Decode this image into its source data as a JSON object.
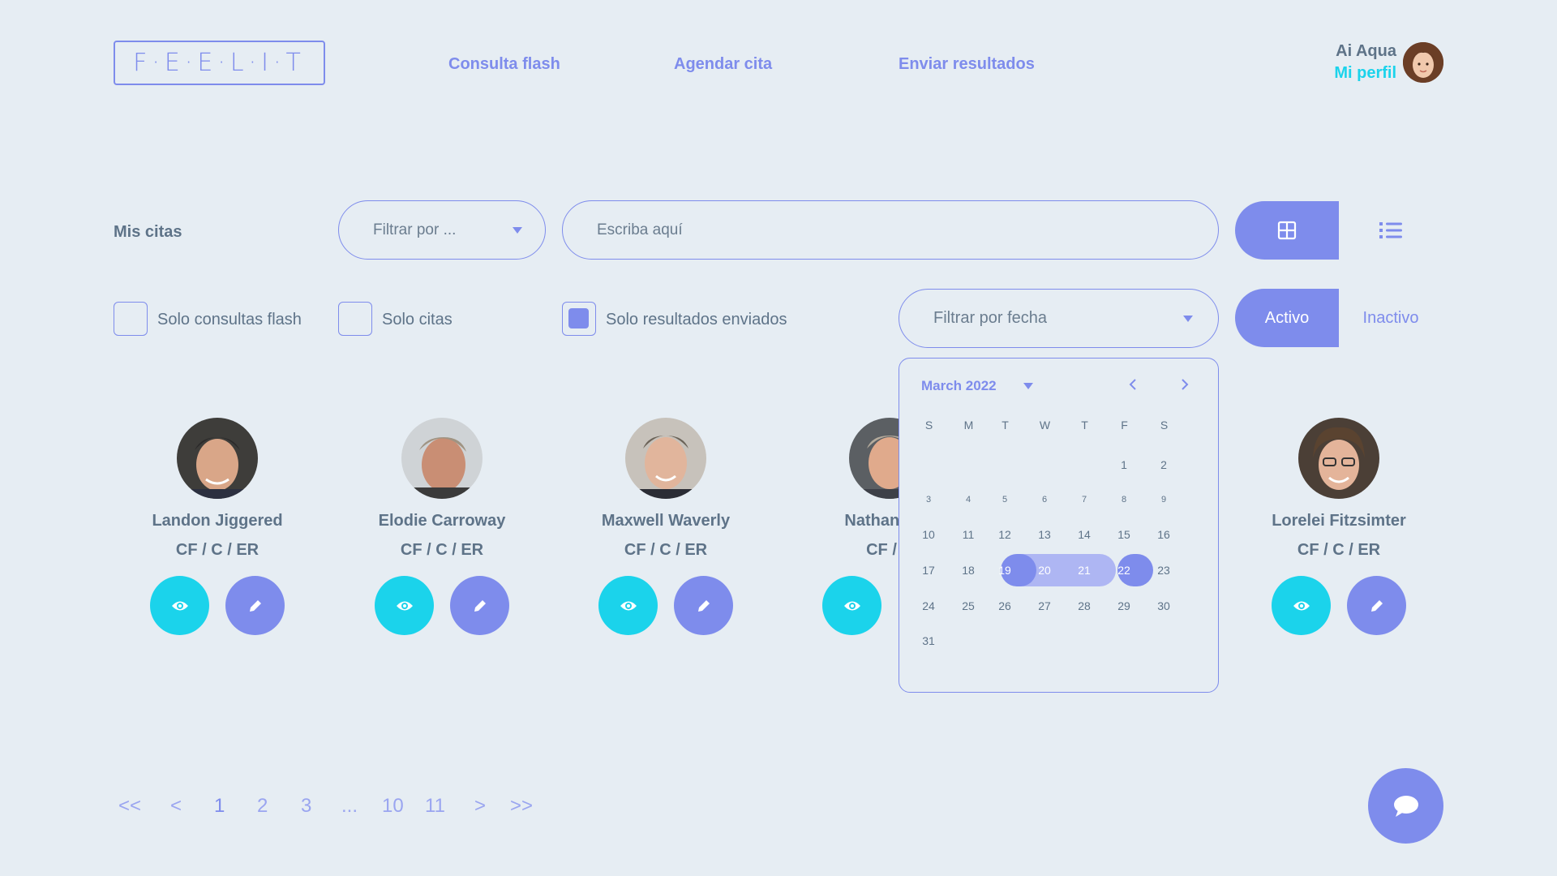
{
  "header": {
    "logo_text": "F·E·E·L·I·T",
    "nav": [
      {
        "label": "Consulta flash"
      },
      {
        "label": "Agendar cita"
      },
      {
        "label": "Enviar resultados"
      }
    ],
    "user": {
      "name": "Ai Aqua",
      "profile_link": "Mi perfil"
    }
  },
  "toolbar": {
    "section_title": "Mis citas",
    "filter_select": {
      "value": "Filtrar por  ..."
    },
    "search": {
      "placeholder": "Escriba aquí"
    },
    "view_grid_icon": "grid-icon",
    "view_list_icon": "list-icon"
  },
  "filters": {
    "checkboxes": [
      {
        "label": "Solo consultas flash",
        "checked": false
      },
      {
        "label": "Solo citas",
        "checked": false
      },
      {
        "label": "Solo resultados enviados",
        "checked": true
      }
    ],
    "date_select": {
      "value": "Filtrar por fecha"
    },
    "status": {
      "active_label": "Activo",
      "inactive_label": "Inactivo",
      "selected": "Activo"
    }
  },
  "calendar": {
    "month_label": "March 2022",
    "weekdays": [
      "S",
      "M",
      "T",
      "W",
      "T",
      "F",
      "S"
    ],
    "weeks": [
      [
        "",
        "",
        "",
        "",
        "",
        "1",
        "2"
      ],
      [
        "3",
        "4",
        "5",
        "6",
        "7",
        "8",
        "9"
      ],
      [
        "10",
        "11",
        "12",
        "13",
        "14",
        "15",
        "16"
      ],
      [
        "17",
        "18",
        "19",
        "20",
        "21",
        "22",
        "23"
      ],
      [
        "24",
        "25",
        "26",
        "27",
        "28",
        "29",
        "30"
      ],
      [
        "31",
        "",
        "",
        "",
        "",
        "",
        ""
      ]
    ],
    "range_start": "19",
    "range_end": "22"
  },
  "cards": [
    {
      "name": "Landon Jiggered",
      "tags": "CF / C / ER"
    },
    {
      "name": "Elodie Carroway",
      "tags": "CF / C / ER"
    },
    {
      "name": "Maxwell Waverly",
      "tags": "CF / C / ER"
    },
    {
      "name": "Nathaniel G",
      "tags": "CF / C"
    },
    {
      "name": "Lorelei Fitzsimter",
      "tags": "CF / C / ER"
    }
  ],
  "pagination": {
    "first": "<<",
    "prev": "<",
    "pages": [
      "1",
      "2",
      "3",
      "...",
      "10",
      "11"
    ],
    "current": "1",
    "next": ">",
    "last": ">>"
  },
  "colors": {
    "accent": "#7e8cec",
    "cyan": "#1bd3eb",
    "text": "#5e7388",
    "background": "#e6edf3"
  }
}
